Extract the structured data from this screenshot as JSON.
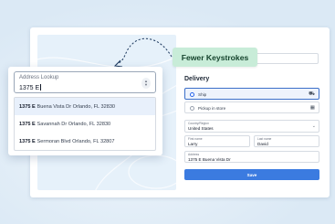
{
  "badge": {
    "text": "Fewer Keystrokes"
  },
  "lookup": {
    "label": "Address Lookup",
    "value": "1375 E",
    "suggestions": [
      {
        "match": "1375 E",
        "rest": "Buena Vista Dr Orlando, FL 32830"
      },
      {
        "match": "1375 E",
        "rest": "Savannah Dr Orlando, FL 32830"
      },
      {
        "match": "1375 E",
        "rest": "Sermoran Blvd Orlando, FL 32807"
      }
    ]
  },
  "delivery": {
    "title": "Delivery",
    "options": [
      {
        "label": "Ship",
        "icon": "truck-icon",
        "selected": true
      },
      {
        "label": "Pickup in store",
        "icon": "store-icon",
        "selected": false
      }
    ]
  },
  "form": {
    "country_label": "Country/Region",
    "country_value": "United States",
    "first_name_label": "First name",
    "first_name_value": "Larry",
    "last_name_label": "Last name",
    "last_name_value": "David",
    "address_label": "Address",
    "address_value": "1375 E Buena Vista Dr"
  },
  "save_button": {
    "label": "Save"
  },
  "colors": {
    "background": "#dbe9f5",
    "badge": "#c8ecd8",
    "primary_button": "#3b7be0",
    "selected_option": "#eef3fc"
  }
}
